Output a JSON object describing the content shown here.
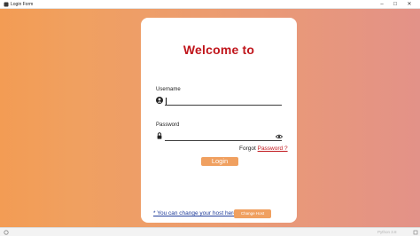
{
  "window": {
    "title": "Login Form",
    "icons": [
      "app-icon",
      "minimize-icon",
      "maximize-icon",
      "close-icon"
    ]
  },
  "colors": {
    "gradient_left": "#f39c54",
    "gradient_right": "#e39288",
    "heading": "#c0161c",
    "button": "#f0a060",
    "link_red": "#c0161c",
    "link_blue": "#1f3c9a"
  },
  "login": {
    "heading": "Welcome to",
    "username_label": "Username",
    "username_value": "",
    "password_label": "Password",
    "password_value": "",
    "forgot_prefix": "Forgot",
    "forgot_link": "Password ?",
    "login_button": "Login",
    "icons": [
      "user-icon",
      "lock-icon",
      "eye-icon"
    ]
  },
  "host": {
    "link_text": "* You can change your host here:",
    "button": "Change Host"
  },
  "statusbar": {
    "text": "Python 3.8"
  }
}
